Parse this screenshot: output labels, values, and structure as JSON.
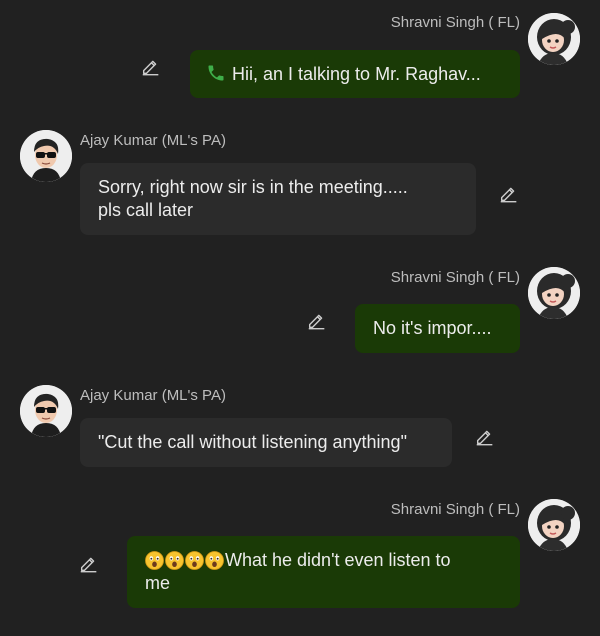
{
  "messages": [
    {
      "sender": "Shravni Singh ( FL)",
      "text": "Hii, an I talking to Mr. Raghav...",
      "direction": "outgoing",
      "icon": "phone-icon"
    },
    {
      "sender": "Ajay Kumar (ML's PA)",
      "line1": "Sorry, right now sir is in the meeting.....",
      "line2": "pls call later",
      "direction": "incoming"
    },
    {
      "sender": "Shravni Singh ( FL)",
      "text": "No it's impor....",
      "direction": "outgoing"
    },
    {
      "sender": "Ajay Kumar (ML's PA)",
      "text": "\"Cut the call without listening anything\"",
      "direction": "incoming"
    },
    {
      "sender": "Shravni Singh ( FL)",
      "line1": "What he didn't even listen to",
      "line2": "me",
      "emoji_count": 4,
      "emoji": "astonished-face",
      "direction": "outgoing"
    }
  ],
  "colors": {
    "background": "#212121",
    "outgoing_bubble": "#1a3a06",
    "incoming_bubble": "#2b2b2b",
    "sender_name": "#bdbdbd",
    "phone_icon": "#3fae49"
  }
}
